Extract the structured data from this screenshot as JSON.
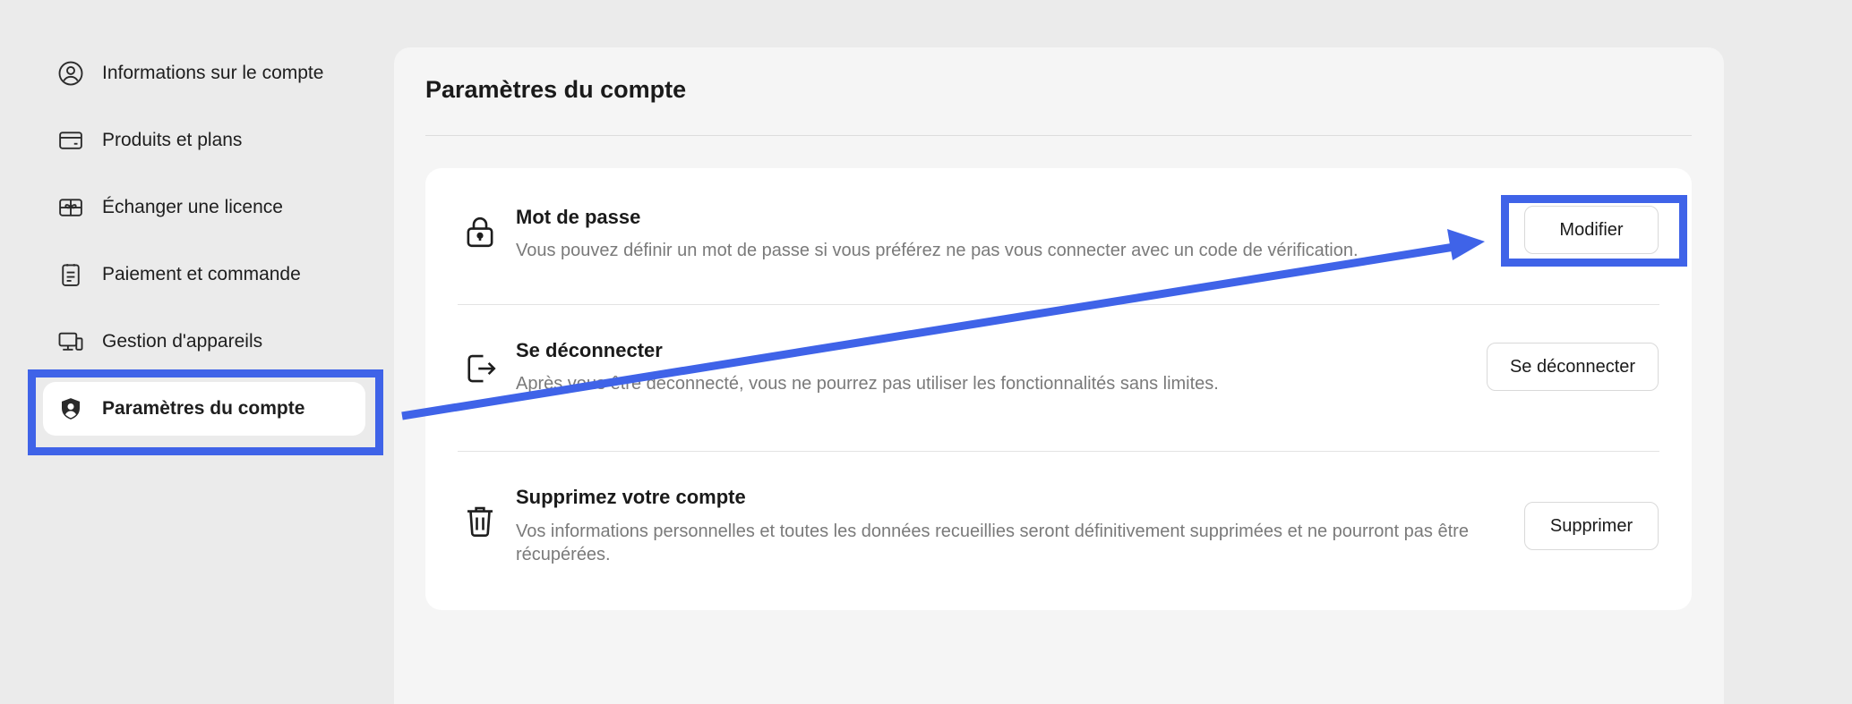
{
  "sidebar": {
    "items": [
      {
        "label": "Informations sur le compte",
        "icon": "user-circle-icon",
        "active": false
      },
      {
        "label": "Produits et plans",
        "icon": "credit-card-icon",
        "active": false
      },
      {
        "label": "Échanger une licence",
        "icon": "gift-card-icon",
        "active": false
      },
      {
        "label": "Paiement et commande",
        "icon": "clipboard-list-icon",
        "active": false
      },
      {
        "label": "Gestion d'appareils",
        "icon": "devices-icon",
        "active": false
      },
      {
        "label": "Paramètres du compte",
        "icon": "user-shield-icon",
        "active": true
      }
    ]
  },
  "main": {
    "title": "Paramètres du compte",
    "rows": [
      {
        "title": "Mot de passe",
        "description": "Vous pouvez définir un mot de passe si vous préférez ne pas vous connecter avec un code de vérification.",
        "button": "Modifier",
        "icon": "lock-icon"
      },
      {
        "title": "Se déconnecter",
        "description": "Après vous être déconnecté, vous ne pourrez pas utiliser les fonctionnalités sans limites.",
        "button": "Se déconnecter",
        "icon": "logout-icon"
      },
      {
        "title": "Supprimez votre compte",
        "description": "Vos informations personnelles et toutes les données recueillies seront définitivement supprimées et ne pourront pas être récupérées.",
        "button": "Supprimer",
        "icon": "trash-icon"
      }
    ]
  },
  "annotation": {
    "color": "#3f63e8"
  }
}
